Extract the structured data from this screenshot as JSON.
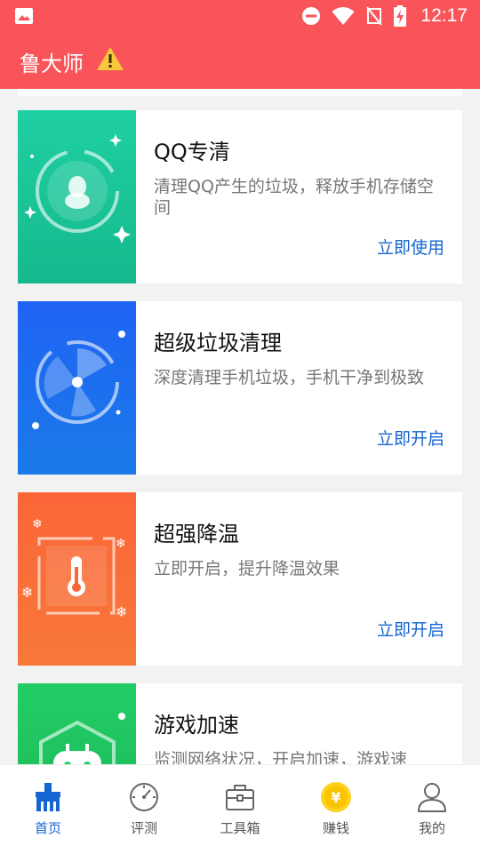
{
  "status_bar": {
    "time": "12:17"
  },
  "app_bar": {
    "title": "鲁大师"
  },
  "cards": [
    {
      "title": "QQ专清",
      "description": "清理QQ产生的垃圾，释放手机存储空间",
      "action": "立即使用",
      "color": "#1fc89a"
    },
    {
      "title": "超级垃圾清理",
      "description": "深度清理手机垃圾，手机干净到极致",
      "action": "立即开启",
      "color": "#1d6ff0"
    },
    {
      "title": "超强降温",
      "description": "立即开启，提升降温效果",
      "action": "立即开启",
      "color": "#fa6a3a"
    },
    {
      "title": "游戏加速",
      "description": "监测网络状况，开启加速，游戏速",
      "color": "#27c764"
    }
  ],
  "bottom_nav": {
    "items": [
      {
        "label": "首页",
        "icon": "broom-icon",
        "active": true
      },
      {
        "label": "评测",
        "icon": "gauge-icon",
        "active": false
      },
      {
        "label": "工具箱",
        "icon": "toolbox-icon",
        "active": false
      },
      {
        "label": "赚钱",
        "icon": "coin-icon",
        "active": false
      },
      {
        "label": "我的",
        "icon": "person-icon",
        "active": false
      }
    ]
  },
  "colors": {
    "accent": "#f95459",
    "link": "#1464d2",
    "active_nav": "#1464d2"
  }
}
